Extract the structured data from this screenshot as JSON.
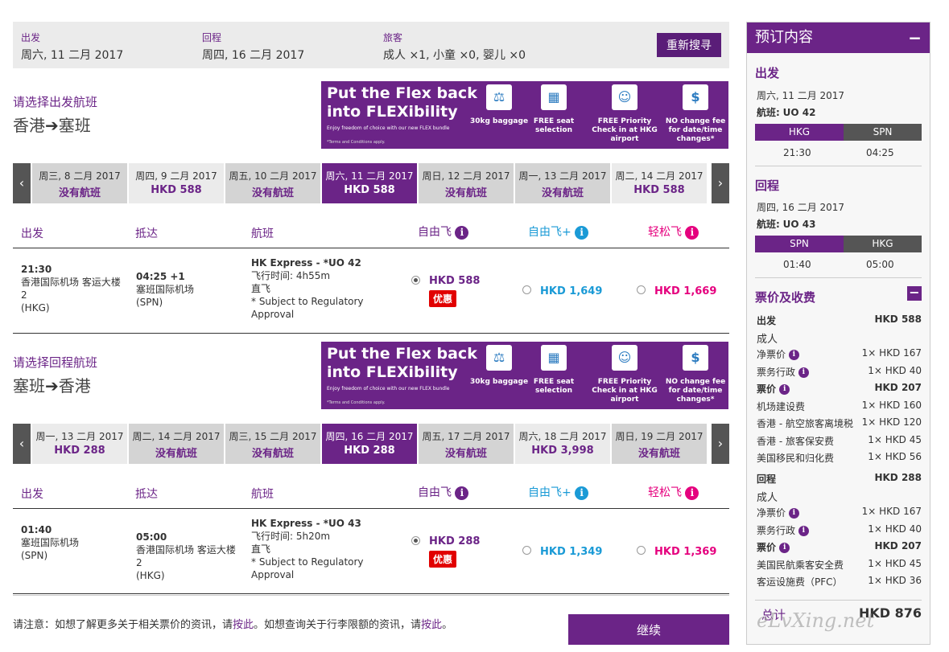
{
  "summary": {
    "depart_label": "出发",
    "depart_value": "周六, 11 二月 2017",
    "return_label": "回程",
    "return_value": "周四, 16 二月 2017",
    "pax_label": "旅客",
    "pax_value": "成人 ×1, 小童 ×0, 婴儿 ×0",
    "research_button": "重新搜寻"
  },
  "outbound": {
    "title": "请选择出发航班",
    "from": "香港",
    "to": "塞班",
    "arrow": "➔",
    "dates": [
      {
        "day": "周三, 8 二月 2017",
        "price": "没有航班",
        "style": "gray"
      },
      {
        "day": "周四, 9 二月 2017",
        "price": "HKD 588",
        "style": "light"
      },
      {
        "day": "周五, 10 二月 2017",
        "price": "没有航班",
        "style": "gray"
      },
      {
        "day": "周六, 11 二月 2017",
        "price": "HKD 588",
        "style": "sel"
      },
      {
        "day": "周日, 12 二月 2017",
        "price": "没有航班",
        "style": "gray"
      },
      {
        "day": "周一, 13 二月 2017",
        "price": "没有航班",
        "style": "gray"
      },
      {
        "day": "周二, 14 二月 2017",
        "price": "HKD 588",
        "style": "light"
      }
    ],
    "flight": {
      "dep_time": "21:30",
      "dep_airport": "香港国际机场 客运大楼 2",
      "dep_code": "(HKG)",
      "arr_time": "04:25 +1",
      "arr_airport": "塞班国际机场",
      "arr_code": "(SPN)",
      "flight_name": "HK Express - *UO 42",
      "duration": "飞行时间: 4h55m",
      "type": "直飞",
      "note": "* Subject to Regulatory Approval",
      "fare1": "HKD 588",
      "fare1_badge": "优惠",
      "fare2": "HKD 1,649",
      "fare3": "HKD 1,669"
    }
  },
  "inbound": {
    "title": "请选择回程航班",
    "from": "塞班",
    "to": "香港",
    "arrow": "➔",
    "dates": [
      {
        "day": "周一, 13 二月 2017",
        "price": "HKD 288",
        "style": "light"
      },
      {
        "day": "周二, 14 二月 2017",
        "price": "没有航班",
        "style": "gray"
      },
      {
        "day": "周三, 15 二月 2017",
        "price": "没有航班",
        "style": "gray"
      },
      {
        "day": "周四, 16 二月 2017",
        "price": "HKD 288",
        "style": "sel"
      },
      {
        "day": "周五, 17 二月 2017",
        "price": "没有航班",
        "style": "gray"
      },
      {
        "day": "周六, 18 二月 2017",
        "price": "HKD 3,998",
        "style": "light"
      },
      {
        "day": "周日, 19 二月 2017",
        "price": "没有航班",
        "style": "gray"
      }
    ],
    "flight": {
      "dep_time": "01:40",
      "dep_airport": "塞班国际机场",
      "dep_code": "(SPN)",
      "arr_time": "05:00",
      "arr_airport": "香港国际机场 客运大楼 2",
      "arr_code": "(HKG)",
      "flight_name": "HK Express - *UO 43",
      "duration": "飞行时间: 5h20m",
      "type": "直飞",
      "note": "* Subject to Regulatory Approval",
      "fare1": "HKD 288",
      "fare1_badge": "优惠",
      "fare2": "HKD 1,349",
      "fare3": "HKD 1,369"
    }
  },
  "columns": {
    "depart": "出发",
    "arrive": "抵达",
    "flight": "航班",
    "fare1": "自由飞",
    "fare2": "自由飞+",
    "fare3": "轻松飞"
  },
  "banner": {
    "title1": "Put the Flex back",
    "title2": "into FLEXibility",
    "sub": "Enjoy freedom of choice with our new FLEX bundle",
    "terms": "*Terms and Conditions apply.",
    "f1": "30kg baggage",
    "f2": "FREE seat selection",
    "f3": "FREE Priority Check in at HKG airport",
    "f4": "NO change fee for date/time changes*"
  },
  "note": {
    "t1": "请注意：如想了解更多关于相关票价的资讯，请",
    "l1": "按此",
    "t2": "。如想查询关于行李限额的资讯，请",
    "l2": "按此",
    "t3": "。"
  },
  "continue_button": "继续",
  "sidebar": {
    "header": "预订内容",
    "minimize": "−",
    "out_title": "出发",
    "out_date": "周六, 11 二月 2017",
    "out_flight_label": "航班:",
    "out_flight": "UO 42",
    "out_from": "HKG",
    "out_to": "SPN",
    "out_dep": "21:30",
    "out_arr": "04:25",
    "ret_title": "回程",
    "ret_date": "周四, 16 二月 2017",
    "ret_flight_label": "航班:",
    "ret_flight": "UO 43",
    "ret_from": "SPN",
    "ret_to": "HKG",
    "ret_dep": "01:40",
    "ret_arr": "05:00",
    "fees_title": "票价及收费",
    "fees_out": {
      "label": "出发",
      "total": "HKD 588",
      "pax": "成人",
      "rows": [
        {
          "n": "净票价",
          "v": "1× HKD 167",
          "i": true
        },
        {
          "n": "票务行政",
          "v": "1× HKD 40",
          "i": true
        },
        {
          "n": "票价",
          "v": "HKD 207",
          "i": true,
          "b": true
        },
        {
          "n": "机场建设费",
          "v": "1× HKD 160"
        },
        {
          "n": "香港 - 航空旅客离境税",
          "v": "1× HKD 120"
        },
        {
          "n": "香港 - 旅客保安费",
          "v": "1× HKD 45"
        },
        {
          "n": "美国移民和归化费",
          "v": "1× HKD 56"
        }
      ]
    },
    "fees_ret": {
      "label": "回程",
      "total": "HKD 288",
      "pax": "成人",
      "rows": [
        {
          "n": "净票价",
          "v": "1× HKD 167",
          "i": true
        },
        {
          "n": "票务行政",
          "v": "1× HKD 40",
          "i": true
        },
        {
          "n": "票价",
          "v": "HKD 207",
          "i": true,
          "b": true
        },
        {
          "n": "美国民航乘客安全费",
          "v": "1× HKD 45"
        },
        {
          "n": "客运设施费（PFC）",
          "v": "1× HKD 36"
        }
      ]
    },
    "total_label": "总计",
    "total_value": "HKD 876"
  },
  "watermark": "eLvXing.net",
  "colors": {
    "purple": "#6b2487",
    "blue": "#1a9ad6",
    "pink": "#e5007e",
    "red": "#e10000"
  }
}
